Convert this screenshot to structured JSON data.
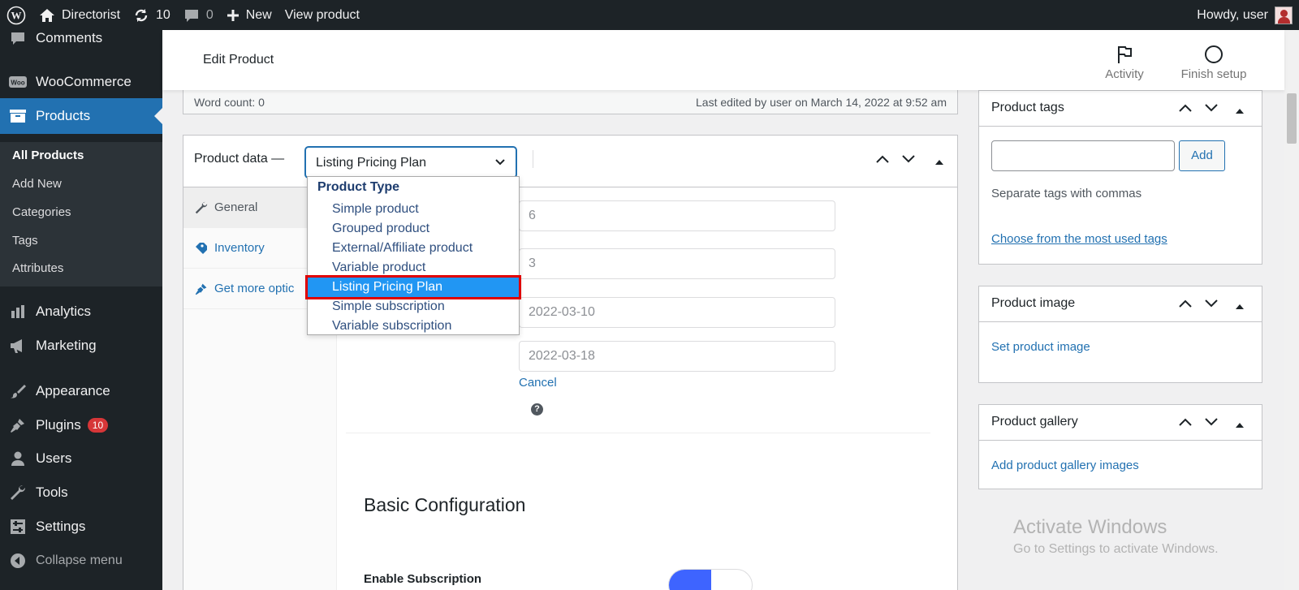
{
  "adminbar": {
    "site_name": "Directorist",
    "updates_count": "10",
    "comments_count": "0",
    "new_label": "New",
    "view_product": "View product",
    "howdy": "Howdy, user"
  },
  "sidebar": {
    "comments": "Comments",
    "woocommerce": "WooCommerce",
    "products": "Products",
    "products_sub": [
      "All Products",
      "Add New",
      "Categories",
      "Tags",
      "Attributes"
    ],
    "analytics": "Analytics",
    "marketing": "Marketing",
    "appearance": "Appearance",
    "plugins": "Plugins",
    "plugins_badge": "10",
    "users": "Users",
    "tools": "Tools",
    "settings": "Settings",
    "collapse": "Collapse menu"
  },
  "header": {
    "title": "Edit Product",
    "activity": "Activity",
    "finish_setup": "Finish setup"
  },
  "wordbar": {
    "word_count": "Word count: 0",
    "last_edited": "Last edited by user on March 14, 2022 at 9:52 am"
  },
  "product_data": {
    "label": "Product data —",
    "selected_type": "Listing Pricing Plan",
    "tabs": [
      "General",
      "Inventory",
      "Get more optic"
    ],
    "fields": [
      "6",
      "3",
      "2022-03-10",
      "2022-03-18"
    ],
    "cancel": "Cancel",
    "help": "?",
    "basic_config": "Basic Configuration",
    "enable_subscription": "Enable Subscription"
  },
  "dropdown": {
    "group": "Product Type",
    "options": [
      "Simple product",
      "Grouped product",
      "External/Affiliate product",
      "Variable product",
      "Listing Pricing Plan",
      "Simple subscription",
      "Variable subscription"
    ],
    "selected_index": 4
  },
  "boxes": {
    "tags_title": "Product tags",
    "tags_add": "Add",
    "tags_help": "Separate tags with commas",
    "tags_most_used": "Choose from the most used tags",
    "image_title": "Product image",
    "image_link": "Set product image",
    "gallery_title": "Product gallery",
    "gallery_link": "Add product gallery images"
  },
  "watermark": {
    "line1": "Activate Windows",
    "line2": "Go to Settings to activate Windows."
  },
  "colors": {
    "admin_dark": "#1d2327",
    "accent": "#2271b1",
    "selected_option": "#2196f3",
    "highlight_outline": "#e00000"
  }
}
